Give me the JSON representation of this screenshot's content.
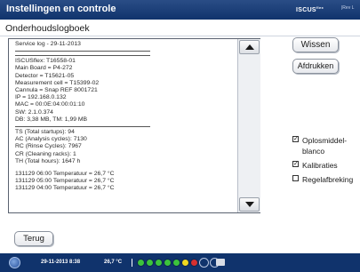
{
  "window": {
    "title": "Instellingen en controle",
    "brand_name": "ISCUS",
    "brand_superscript": "flex",
    "revision": "|Rev L"
  },
  "page": {
    "subtitle": "Onderhoudslogboek"
  },
  "log": {
    "header": "Service log - 29-11-2013",
    "device_info": [
      "ISCUSflex: T16558-01",
      "Main Board = P4-272",
      "Detector = T15621-05",
      "Measurement cell = T15399-02",
      "Cannula = Snap REF 8001721",
      "IP = 192.168.0.132",
      "MAC = 00:0E:04:00:01:10",
      "SW: 2.1.0.374",
      "DB: 3,38 MB, TM: 1,99 MB"
    ],
    "counters": [
      "TS (Total startups): 94",
      "AC (Analysis cycles): 7130",
      "RC (Rinse Cycles): 7967",
      "CR (Cleaning racks): 1",
      "TH (Total hours): 1647 h"
    ],
    "temperatures": [
      "131129 06:00 Temperatuur = 26,7 °C",
      "131129 05:00 Temperatuur = 26,7 °C",
      "131129 04:00 Temperatuur = 26,7 °C"
    ]
  },
  "actions": {
    "clear_label": "Wissen",
    "print_label": "Afdrukken",
    "back_label": "Terug"
  },
  "filters": [
    {
      "label_line1": "Oplosmiddel-",
      "label_line2": "blanco",
      "checked": true
    },
    {
      "label_line1": "Kalibraties",
      "checked": true
    },
    {
      "label_line1": "Regelafbreking",
      "checked": false
    }
  ],
  "status": {
    "date_time": "29-11-2013 8:38",
    "temperature": "26,7 °C",
    "indicator_colors": [
      "#3cc43c",
      "#3cc43c",
      "#3cc43c",
      "#3cc43c",
      "#3cc43c",
      "#f0d820",
      "#d83030"
    ]
  },
  "icons": {
    "logo": "iscus-logo-icon",
    "keyboard": "keyboard-icon",
    "scroll_up": "arrow-up-icon",
    "scroll_down": "arrow-down-icon"
  }
}
